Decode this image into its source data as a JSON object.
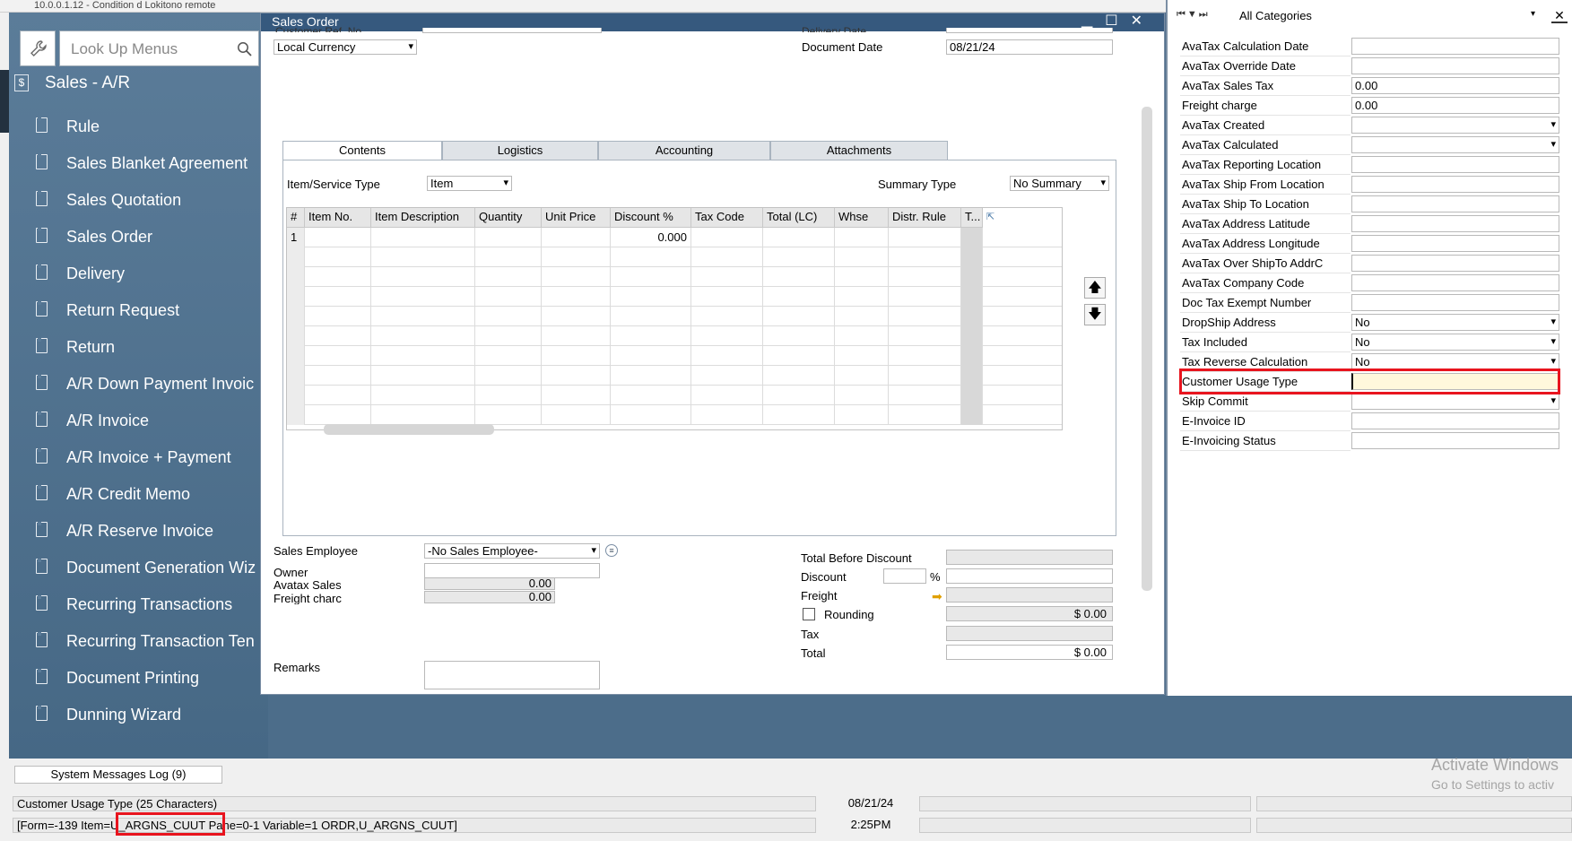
{
  "window_title": "10.0.0.1.12 - Condition d Lokitono remote",
  "nav": {
    "search_placeholder": "Look Up Menus",
    "module": "Sales - A/R",
    "items": [
      "Rule",
      "Sales Blanket Agreement",
      "Sales Quotation",
      "Sales Order",
      "Delivery",
      "Return Request",
      "Return",
      "A/R Down Payment Invoic",
      "A/R Invoice",
      "A/R Invoice + Payment",
      "A/R Credit Memo",
      "A/R Reserve Invoice",
      "Document Generation Wiz",
      "Recurring Transactions",
      "Recurring Transaction Ten",
      "Document Printing",
      "Dunning Wizard"
    ]
  },
  "sales_order": {
    "title": "Sales Order",
    "customer_ref_label": "Customer Ref. No.",
    "currency": "Local Currency",
    "delivery_date_label": "Delivery Date",
    "document_date_label": "Document Date",
    "document_date": "08/21/24",
    "tabs": [
      "Contents",
      "Logistics",
      "Accounting",
      "Attachments"
    ],
    "item_service_type_label": "Item/Service Type",
    "item_service_type": "Item",
    "summary_type_label": "Summary Type",
    "summary_type": "No Summary",
    "grid_columns": [
      "#",
      "Item No.",
      "Item Description",
      "Quantity",
      "Unit Price",
      "Discount %",
      "Tax Code",
      "Total (LC)",
      "Whse",
      "Distr. Rule",
      "T..."
    ],
    "grid_row1_no": "1",
    "grid_row1_discount": "0.000",
    "sales_employee_label": "Sales Employee",
    "sales_employee": "-No Sales Employee-",
    "owner_label": "Owner",
    "avatax_sales_label": "Avatax Sales",
    "avatax_sales": "0.00",
    "freight_charge_label": "Freight charc",
    "freight_charge": "0.00",
    "remarks_label": "Remarks",
    "total_before_discount_label": "Total Before Discount",
    "discount_label": "Discount",
    "percent": "%",
    "freight_label": "Freight",
    "rounding_label": "Rounding",
    "rounding_value": "$ 0.00",
    "tax_label": "Tax",
    "total_label": "Total",
    "total_value": "$ 0.00"
  },
  "udf": {
    "category": "All Categories",
    "fields": [
      {
        "label": "AvaTax Calculation Date",
        "value": ""
      },
      {
        "label": "AvaTax Override Date",
        "value": ""
      },
      {
        "label": "AvaTax Sales Tax",
        "value": "0.00"
      },
      {
        "label": "Freight charge",
        "value": "0.00"
      },
      {
        "label": "AvaTax Created",
        "value": "",
        "dropdown": true
      },
      {
        "label": "AvaTax Calculated",
        "value": "",
        "dropdown": true
      },
      {
        "label": "AvaTax Reporting Location",
        "value": ""
      },
      {
        "label": "AvaTax Ship From Location",
        "value": ""
      },
      {
        "label": "AvaTax Ship To Location",
        "value": ""
      },
      {
        "label": "AvaTax Address Latitude",
        "value": ""
      },
      {
        "label": "AvaTax Address Longitude",
        "value": ""
      },
      {
        "label": "AvaTax Over ShipTo AddrC",
        "value": ""
      },
      {
        "label": "AvaTax Company Code",
        "value": ""
      },
      {
        "label": "Doc Tax Exempt Number",
        "value": ""
      },
      {
        "label": "DropShip Address",
        "value": "No",
        "dropdown": true
      },
      {
        "label": "Tax Included",
        "value": "No",
        "dropdown": true
      },
      {
        "label": "Tax Reverse Calculation",
        "value": "No",
        "dropdown": true
      },
      {
        "label": "Customer Usage Type",
        "value": "",
        "highlight": true
      },
      {
        "label": "Skip Commit",
        "value": "",
        "dropdown": true
      },
      {
        "label": "E-Invoice ID",
        "value": ""
      },
      {
        "label": "E-Invoicing Status",
        "value": ""
      }
    ]
  },
  "status": {
    "messages_log": "System Messages Log (9)",
    "field_info": "Customer Usage Type (25 Characters)",
    "form_info": "[Form=-139 Item=U_ARGNS_CUUT Pane=0-1 Variable=1 ORDR,U_ARGNS_CUUT]",
    "date": "08/21/24",
    "time": "2:25PM"
  },
  "watermark": {
    "line1": "Activate Windows",
    "line2": "Go to Settings to activ"
  },
  "colors": {
    "nav_bg": "#506f8d",
    "titlebar": "#36597e",
    "highlight_red": "#e8141e",
    "highlight_field": "#fff8dc"
  }
}
